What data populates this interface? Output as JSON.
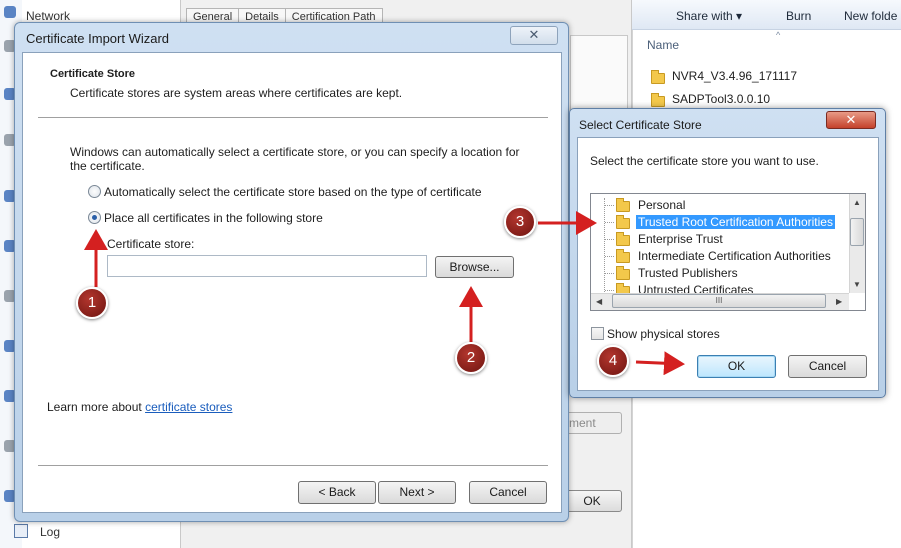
{
  "background_nav": {
    "network_label": "Network",
    "log_label": "Log"
  },
  "background_properties": {
    "tabs": [
      {
        "label": "General"
      },
      {
        "label": "Details"
      },
      {
        "label": "Certification Path"
      }
    ],
    "ok_label": "OK",
    "partial_button_label": "ment"
  },
  "background_explorer": {
    "toolbar": {
      "share_label": "Share with ▾",
      "burn_label": "Burn",
      "new_folder_label": "New folde"
    },
    "column_name": "Name",
    "files": [
      {
        "name": "NVR4_V3.4.96_171117",
        "icon": "folder-icon"
      },
      {
        "name": "SADPTool3.0.0.10",
        "icon": "folder-icon"
      }
    ]
  },
  "wizard": {
    "title": "Certificate Import Wizard",
    "close_glyph": "✕",
    "step_title": "Certificate Store",
    "step_description": "Certificate stores are system areas where certificates are kept.",
    "intro": "Windows can automatically select a certificate store, or you can specify a location for the certificate.",
    "radio_auto_label": "Automatically select the certificate store based on the type of certificate",
    "radio_place_label": "Place all certificates in the following store",
    "radio_selected": "place",
    "cert_store_label": "Certificate store:",
    "cert_store_value": "",
    "browse_label": "Browse...",
    "learn_more_prefix": "Learn more about ",
    "learn_more_link": "certificate stores",
    "back_label": "< Back",
    "next_label": "Next >",
    "cancel_label": "Cancel"
  },
  "select_store_dialog": {
    "title": "Select Certificate Store",
    "close_glyph": "✕",
    "description": "Select the certificate store you want to use.",
    "stores": [
      {
        "label": "Personal",
        "selected": false
      },
      {
        "label": "Trusted Root Certification Authorities",
        "selected": true
      },
      {
        "label": "Enterprise Trust",
        "selected": false
      },
      {
        "label": "Intermediate Certification Authorities",
        "selected": false
      },
      {
        "label": "Trusted Publishers",
        "selected": false
      },
      {
        "label": "Untrusted Certificates",
        "selected": false
      }
    ],
    "scroll_grip": "III",
    "show_physical_label": "Show physical stores",
    "show_physical_checked": false,
    "ok_label": "OK",
    "cancel_label": "Cancel"
  },
  "annotations": {
    "steps": [
      {
        "number": "1"
      },
      {
        "number": "2"
      },
      {
        "number": "3"
      },
      {
        "number": "4"
      }
    ],
    "badge_color": "#8b1a14",
    "arrow_color": "#d42020"
  }
}
